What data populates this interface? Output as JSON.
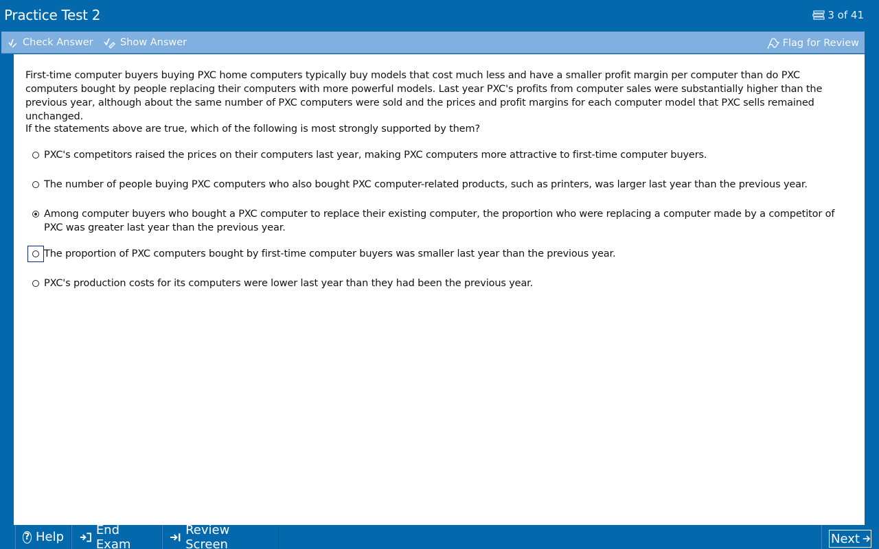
{
  "window": {
    "title": "Practice Test 2",
    "counter": "3 of 41",
    "counter_icon": "stack-icon"
  },
  "toolbar": {
    "check_answer": "Check Answer",
    "show_answer": "Show Answer",
    "flag_review": "Flag for Review"
  },
  "question": {
    "stimulus": "First-time computer buyers buying PXC home computers typically buy models that cost much less and have a smaller profit margin per computer than do PXC computers bought by people replacing their computers with more powerful models.  Last year PXC's profits from computer sales were substantially higher than the previous year, although about the same number of PXC computers were sold and the prices and profit margins for each computer model that PXC sells remained unchanged.",
    "prompt": "If the statements above are true, which of the following is most strongly supported by them?",
    "options": [
      {
        "text": "PXC's competitors raised the prices on their computers last year, making PXC computers more attractive to first-time computer buyers.",
        "selected": false,
        "focused": false
      },
      {
        "text": "The number of people buying PXC computers who also bought PXC computer-related products, such as printers, was larger last year than the previous year.",
        "selected": false,
        "focused": false
      },
      {
        "text": "Among computer buyers who bought a PXC computer to replace their existing computer, the proportion who were replacing a computer made by a competitor of PXC was greater last year than the previous year.",
        "selected": true,
        "focused": false
      },
      {
        "text": "The proportion of PXC computers bought by first-time computer buyers was smaller last year than the previous year.",
        "selected": false,
        "focused": true
      },
      {
        "text": "PXC's production costs for its computers were lower last year than they had been the previous year.",
        "selected": false,
        "focused": false
      }
    ]
  },
  "bottombar": {
    "help": "Help",
    "end_exam": "End Exam",
    "review_screen": "Review Screen",
    "next": "Next"
  },
  "colors": {
    "frame": "#0468ac",
    "toolbar": "#7fb0e0",
    "content_bg": "#ffffff"
  }
}
